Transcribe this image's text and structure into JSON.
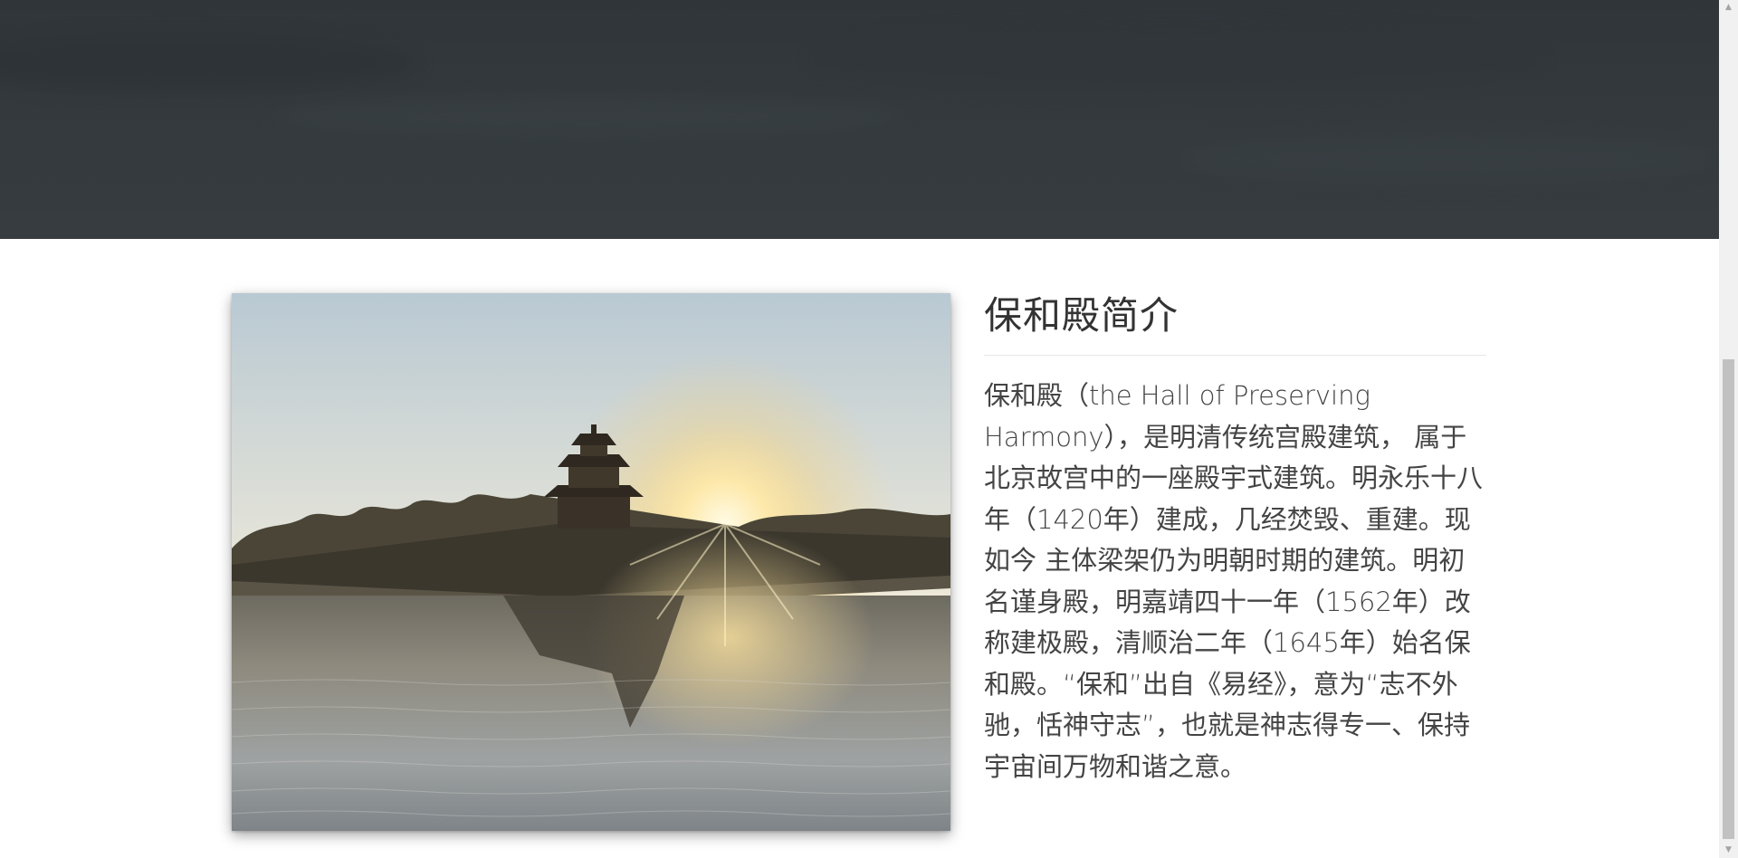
{
  "hero": {
    "background_color": "#33393d"
  },
  "photo": {
    "description_icon": "forbidden-city-corner-tower-photo"
  },
  "info": {
    "title": "保和殿简介",
    "body": "保和殿（the Hall of Preserving Harmony），是明清传统宫殿建筑， 属于北京故宫中的一座殿宇式建筑。明永乐十八年（1420年）建成，几经焚毁、重建。现如今 主体梁架仍为明朝时期的建筑。明初名谨身殿，明嘉靖四十一年（1562年）改称建极殿，清顺治二年（1645年）始名保和殿。“保和”出自《易经》，意为“志不外驰，恬神守志”，也就是神志得专一、保持宇宙间万物和谐之意。"
  },
  "scrollbar": {
    "up_arrow_icon": "chevron-up-icon",
    "down_arrow_icon": "chevron-down-icon"
  }
}
